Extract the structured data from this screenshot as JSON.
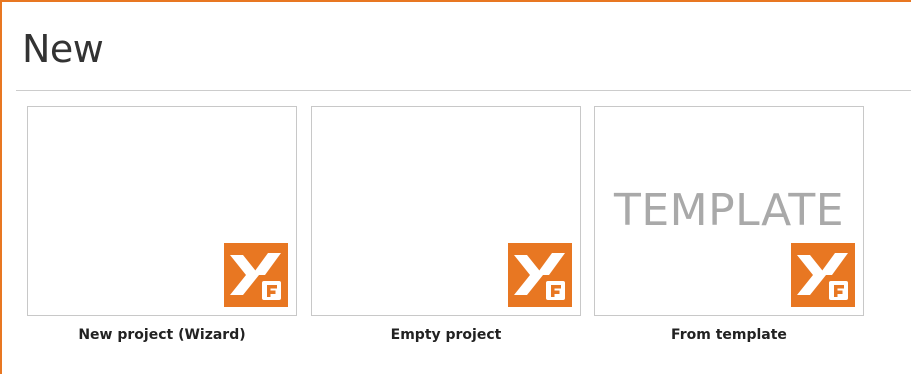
{
  "page": {
    "title": "New"
  },
  "tiles": [
    {
      "label": "New project (Wizard)",
      "preview_text": ""
    },
    {
      "label": "Empty project",
      "preview_text": ""
    },
    {
      "label": "From template",
      "preview_text": "TEMPLATE"
    }
  ],
  "colors": {
    "accent": "#e87722",
    "tile_border": "#c8c8c8",
    "template_text": "#a9a9a9"
  },
  "icons": {
    "logo": "xf-logo-icon"
  }
}
